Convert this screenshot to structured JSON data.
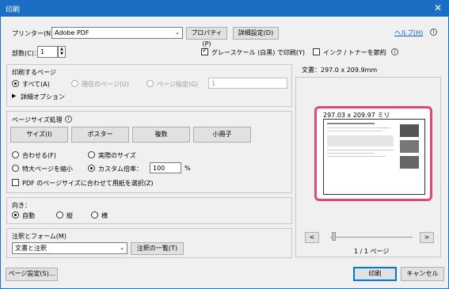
{
  "window": {
    "title": "印刷",
    "close_glyph": "✕"
  },
  "header": {
    "printer_label": "プリンター(N)：",
    "printer_value": "Adobe PDF",
    "properties_button": "プロパティ(P)",
    "advanced_button": "詳細設定(D)",
    "help_link": "ヘルプ(H)",
    "copies_label": "部数(C)：",
    "copies_value": "1",
    "grayscale_label": "グレースケール (白黒) で印刷(Y)",
    "saveink_label": "インク / トナーを節約"
  },
  "pages": {
    "title": "印刷するページ",
    "all": "すべて(A)",
    "current": "現在のページ(U)",
    "specify": "ページ指定(G)",
    "range_value": "1",
    "more_options": "詳細オプション"
  },
  "sizing": {
    "title": "ページサイズ処理",
    "tabs": [
      "サイズ(I)",
      "ポスター",
      "複数",
      "小冊子"
    ],
    "fit": "合わせる(F)",
    "actual": "実際のサイズ",
    "shrink": "特大ページを縮小",
    "custom": "カスタム倍率：",
    "custom_value": "100",
    "percent": "%",
    "paper_by_pdf": "PDF のページサイズに合わせて用紙を選択(Z)"
  },
  "orientation": {
    "title": "向き：",
    "auto": "自動",
    "portrait": "縦",
    "landscape": "横"
  },
  "comments": {
    "title": "注釈とフォーム(M)",
    "value": "文書と注釈",
    "summary_button": "注釈の一覧(T)"
  },
  "preview": {
    "doc_size": "文書：297.0 x 209.9mm",
    "paper_size": "297.03 x 209.97 ミリ",
    "page_indicator": "1 / 1 ページ",
    "prev": "<",
    "next": ">"
  },
  "footer": {
    "page_setup": "ページ設定(S)...",
    "print": "印刷",
    "cancel": "キャンセル"
  },
  "colors": {
    "titlebar": "#1a6fc4",
    "highlight": "#e0457b",
    "link": "#0563c1"
  }
}
